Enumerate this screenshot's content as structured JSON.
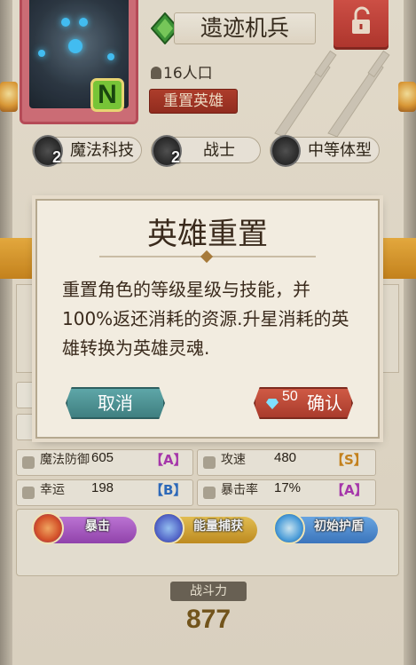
{
  "hero": {
    "name": "遗迹机兵",
    "rarity": "N",
    "population": "16人口",
    "reset_button": "重置英雄"
  },
  "traits": [
    {
      "icon": "tech-icon",
      "count": "2",
      "label": "魔法科技"
    },
    {
      "icon": "warrior-icon",
      "count": "2",
      "label": "战士"
    },
    {
      "icon": "body-type-icon",
      "count": "",
      "label": "中等体型"
    }
  ],
  "stats": {
    "magic_defense": {
      "label": "魔法防御",
      "value": "605",
      "grade": "【A】"
    },
    "attack_speed": {
      "label": "攻速",
      "value": "480",
      "grade": "【S】"
    },
    "luck": {
      "label": "幸运",
      "value": "198",
      "grade": "【B】"
    },
    "crit_rate": {
      "label": "暴击率",
      "value": "17%",
      "grade": "【A】"
    }
  },
  "skills": [
    {
      "label": "暴击",
      "color": "#b55ad0"
    },
    {
      "label": "能量捕获",
      "color": "#d8a935"
    },
    {
      "label": "初始护盾",
      "color": "#4b8fd6"
    }
  ],
  "power": {
    "label": "战斗力",
    "value": "877"
  },
  "dialog": {
    "title": "英雄重置",
    "body": "重置角色的等级星级与技能，并100%返还消耗的资源.升星消耗的英雄转换为英雄灵魂.",
    "cancel_label": "取消",
    "confirm_cost": "50",
    "confirm_label": "确认"
  },
  "colors": {
    "grade_a": "#b03ab5",
    "grade_s": "#d08a20",
    "grade_b": "#2f6fc4"
  }
}
